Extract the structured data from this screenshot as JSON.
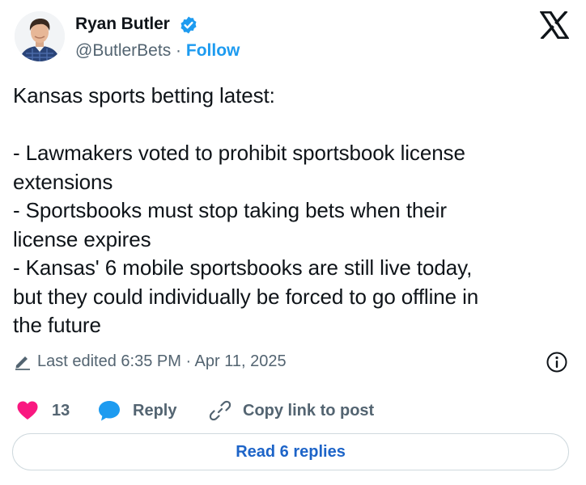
{
  "author": {
    "name": "Ryan Butler",
    "handle": "@ButlerBets",
    "separator": " · ",
    "follow_label": "Follow"
  },
  "tweet": {
    "lines": [
      "Kansas sports betting latest:",
      "",
      "- Lawmakers voted to prohibit sportsbook license",
      "extensions",
      "- Sportsbooks must stop taking bets when their",
      "license expires",
      "- Kansas' 6 mobile sportsbooks are still live today,",
      "but they could individually be forced to go offline in",
      "the future"
    ],
    "edited_text": "Last edited 6:35 PM · Apr 11, 2025"
  },
  "actions": {
    "like_count": "13",
    "reply_label": "Reply",
    "copy_label": "Copy link to post",
    "read_replies_label": "Read 6 replies"
  },
  "icons": {
    "verified": "verified-badge-icon",
    "x_logo": "x-logo-icon",
    "pencil": "pencil-icon",
    "info": "info-icon",
    "heart": "heart-icon",
    "reply": "speech-bubble-icon",
    "link": "link-icon"
  },
  "colors": {
    "accent": "#1d9bf0",
    "heart": "#f91880",
    "muted": "#536471",
    "replies_text": "#1d64c8"
  }
}
